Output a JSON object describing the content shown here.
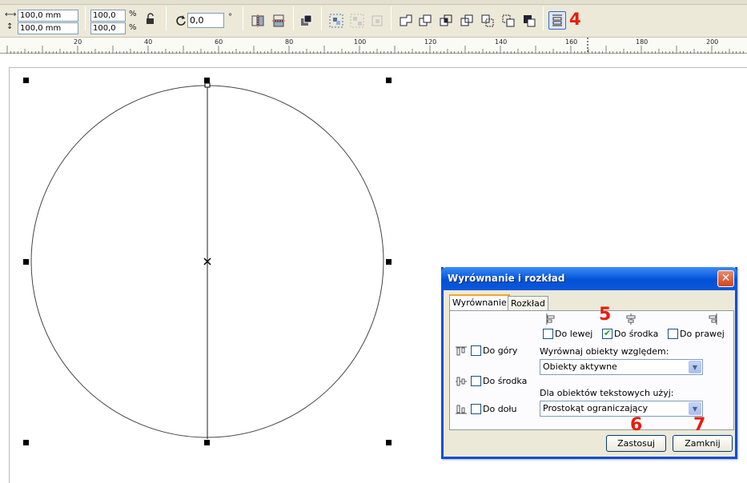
{
  "toolbar": {
    "width_value": "100,0 mm",
    "height_value": "100,0 mm",
    "scale_x": "100,0",
    "scale_y": "100,0",
    "percent_symbol": "%",
    "rotation_value": "0,0",
    "degree_symbol": "°",
    "annotation_number": "4"
  },
  "ruler": {
    "ticks": [
      "20",
      "40",
      "60",
      "80",
      "100",
      "120",
      "140",
      "160",
      "180",
      "200"
    ]
  },
  "dialog": {
    "title": "Wyrównanie i rozkład",
    "close_icon": "close-icon",
    "tabs": [
      "Wyrównanie",
      "Rozkład"
    ],
    "horizontal": {
      "left_label": "Do lewej",
      "center_label": "Do środka",
      "right_label": "Do prawej",
      "center_checked": true
    },
    "vertical": {
      "top_label": "Do góry",
      "middle_label": "Do środka",
      "bottom_label": "Do dołu"
    },
    "align_relative_label": "Wyrównaj obiekty względem:",
    "align_relative_value": "Obiekty aktywne",
    "text_objects_label": "Dla obiektów tekstowych użyj:",
    "text_objects_value": "Prostokąt ograniczający",
    "apply_button": "Zastosuj",
    "close_button": "Zamknij"
  },
  "annotations": {
    "five": "5",
    "six": "6",
    "seven": "7"
  },
  "colors": {
    "annotation_red": "#e81c0c",
    "xp_title_blue": "#0a5de0",
    "xp_face": "#ece9d8"
  }
}
